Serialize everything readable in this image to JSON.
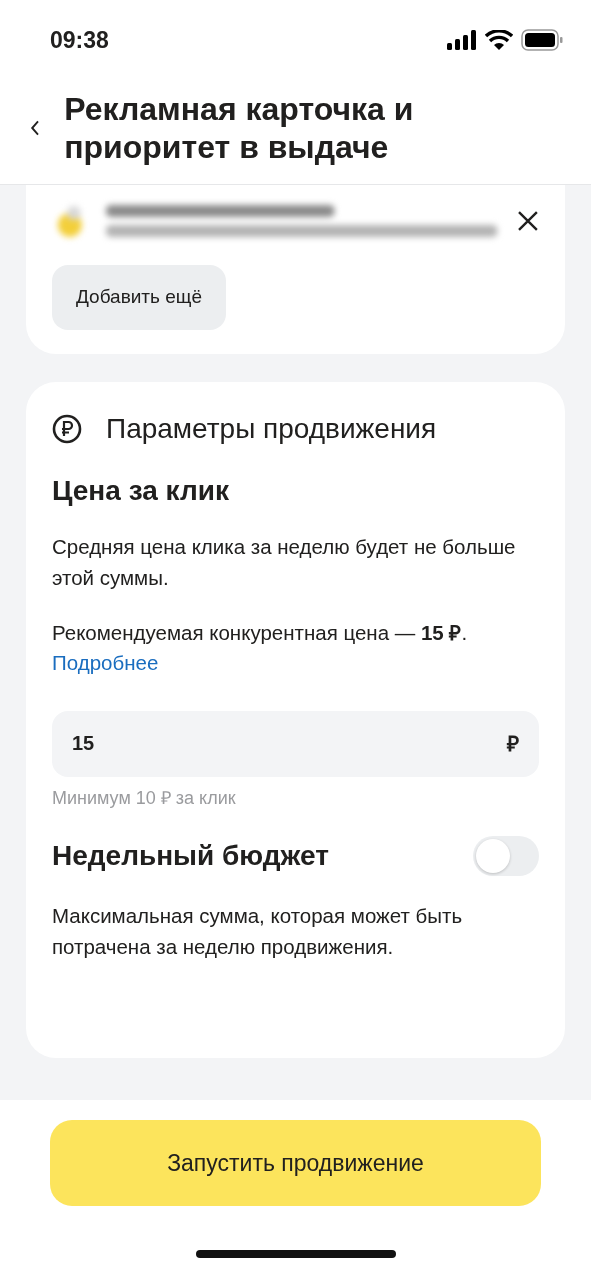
{
  "status_bar": {
    "time": "09:38"
  },
  "header": {
    "title": "Рекламная карточка и приоритет в выдаче"
  },
  "places_card": {
    "add_button": "Добавить ещё"
  },
  "params_card": {
    "title": "Параметры продвижения",
    "price_heading": "Цена за клик",
    "price_description": "Средняя цена клика за неделю будет не больше этой суммы.",
    "recommendation": "Рекомендуемая конкурентная цена — **15 ₽**.",
    "more_link": "Подробнее",
    "price_field": {
      "value": "15",
      "currency": "₽"
    },
    "price_hint": "Минимум 10 ₽ за клик",
    "budget_heading": "Недельный бюджет",
    "budget_toggle": {
      "on": false
    },
    "budget_description": "Максимальная сумма, которая может быть потрачена за неделю продвижения."
  },
  "launch_button": "Запустить продвижение"
}
